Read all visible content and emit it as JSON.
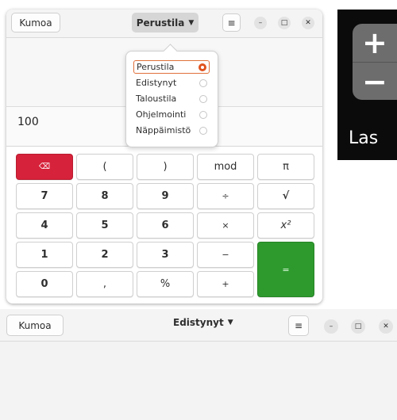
{
  "dock": {
    "plus_symbol": "+",
    "minus_symbol": "−",
    "label": "Las"
  },
  "calculator": {
    "undo_label": "Kumoa",
    "mode_label": "Perustila",
    "menu_icon": "≡",
    "window_controls": {
      "minimize": "–",
      "maximize": "□",
      "close": "✕"
    },
    "display_value": "100",
    "mode_menu": [
      {
        "label": "Perustila",
        "selected": true
      },
      {
        "label": "Edistynyt",
        "selected": false
      },
      {
        "label": "Taloustila",
        "selected": false
      },
      {
        "label": "Ohjelmointi",
        "selected": false
      },
      {
        "label": "Näppäimistö",
        "selected": false
      }
    ],
    "keys": {
      "backspace": "⌫",
      "open_paren": "(",
      "close_paren": ")",
      "mod": "mod",
      "pi": "π",
      "seven": "7",
      "eight": "8",
      "nine": "9",
      "divide": "÷",
      "sqrt": "√",
      "four": "4",
      "five": "5",
      "six": "6",
      "multiply": "×",
      "square": "x²",
      "one": "1",
      "two": "2",
      "three": "3",
      "subtract": "−",
      "equals": "=",
      "zero": "0",
      "comma": ",",
      "percent": "%",
      "add": "+"
    }
  },
  "second_window": {
    "undo_label": "Kumoa",
    "mode_label": "Edistynyt",
    "menu_icon": "≡",
    "window_controls": {
      "minimize": "–",
      "maximize": "□",
      "close": "✕"
    }
  },
  "colors": {
    "delete_key": "#d6223a",
    "equals_key": "#2e9a2e",
    "radio_accent": "#e0531f"
  }
}
